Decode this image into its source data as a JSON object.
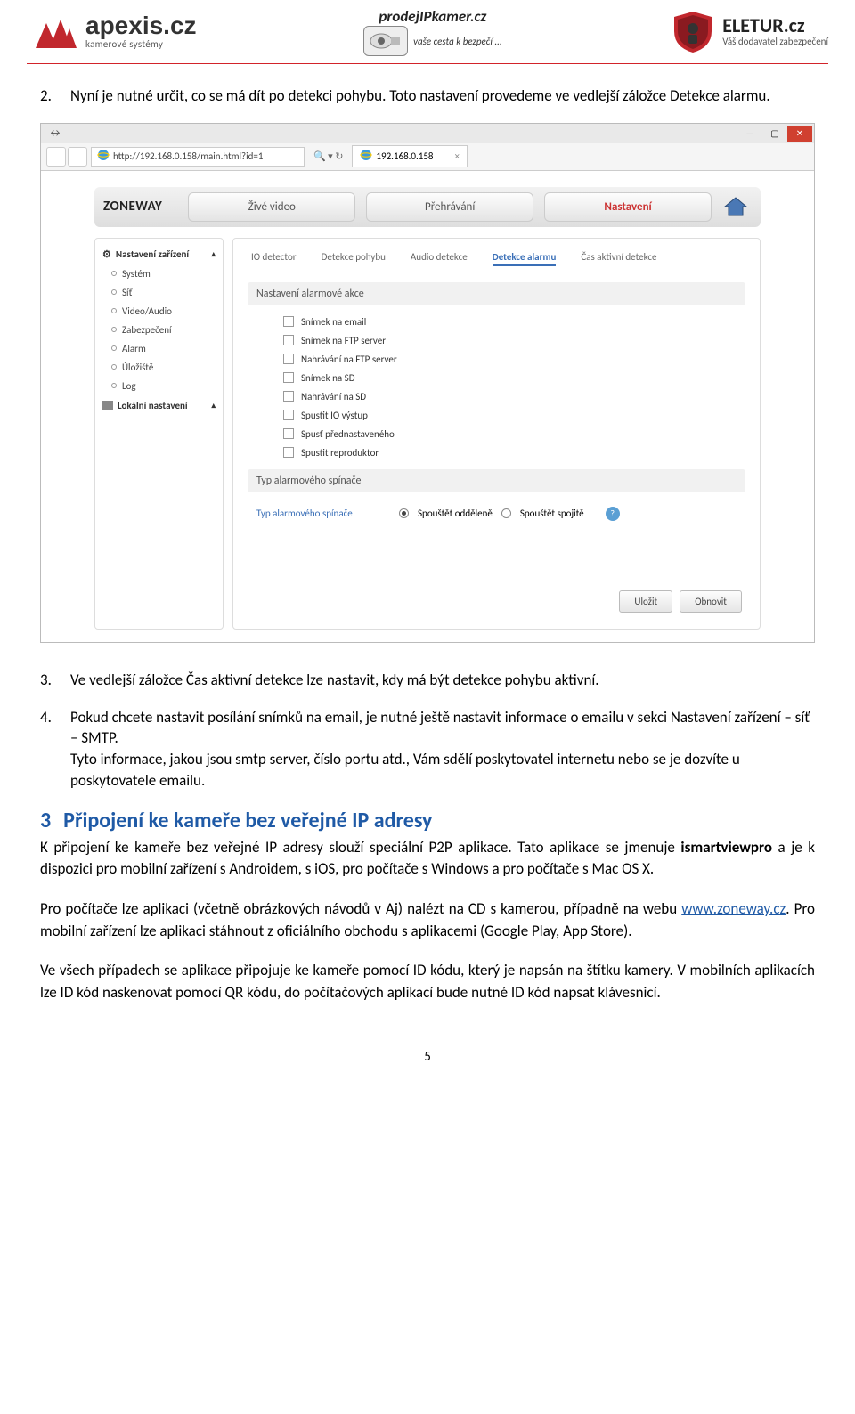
{
  "logos": {
    "apexis_main": "apexis.cz",
    "apexis_sub": "kamerové systémy",
    "prodej_top": "prodejIPkamer.cz",
    "prodej_slogan": "vaše cesta k bezpečí ...",
    "eletur_main": "ELETUR.cz",
    "eletur_sub": "Váš dodavatel zabezpečení"
  },
  "doc": {
    "item2_num": "2.",
    "item2": "Nyní je nutné určit, co se má dít po detekci pohybu. Toto nastavení provedeme ve vedlejší záložce Detekce alarmu.",
    "item3_num": "3.",
    "item3": "Ve vedlejší záložce Čas aktivní detekce lze nastavit, kdy má být detekce pohybu aktivní.",
    "item4_num": "4.",
    "item4": "Pokud chcete nastavit posílání snímků na email, je nutné ještě nastavit informace o emailu v sekci Nastavení zařízení – síť – SMTP.\nTyto informace, jakou jsou smtp server, číslo portu atd., Vám sdělí poskytovatel internetu nebo se je dozvíte u poskytovatele emailu.",
    "h2_num": "3",
    "h2": "Připojení ke kameře bez veřejné IP adresy",
    "p1a": "K připojení ke kameře bez veřejné IP adresy slouží speciální P2P aplikace. Tato aplikace se jmenuje ",
    "p1b": "ismartviewpro",
    "p1c": " a je k dispozici pro mobilní zařízení s Androidem, s iOS, pro počítače s Windows a pro počítače s Mac OS X.",
    "p2a": "Pro počítače lze aplikaci (včetně obrázkových návodů v Aj) nalézt na CD s kamerou, případně na webu ",
    "p2_link": "www.zoneway.cz",
    "p2b": ". Pro mobilní zařízení lze aplikaci stáhnout z oficiálního obchodu s aplikacemi (Google Play, App Store).",
    "p3": "Ve všech případech se aplikace připojuje ke kameře pomocí ID kódu, který je napsán na štítku kamery. V mobilních aplikacích lze ID kód naskenovat pomocí QR kódu, do počítačových aplikací bude nutné ID kód napsat klávesnicí.",
    "pagenum": "5"
  },
  "browser": {
    "url": "http://192.168.0.158/main.html?id=1",
    "tab": "192.168.0.158",
    "app_logo": "ZONEWAY",
    "tabs": {
      "live": "Živé video",
      "playback": "Přehrávání",
      "settings": "Nastavení"
    },
    "sidebar": {
      "head1": "Nastavení zařízení",
      "items": [
        "Systém",
        "Síť",
        "Video/Audio",
        "Zabezpečení",
        "Alarm",
        "Úložiště",
        "Log"
      ],
      "head2": "Lokální nastavení"
    },
    "subtabs": [
      "IO detector",
      "Detekce pohybu",
      "Audio detekce",
      "Detekce alarmu",
      "Čas aktivní detekce"
    ],
    "section1": "Nastavení alarmové akce",
    "checks": [
      "Snímek na email",
      "Snímek na FTP server",
      "Nahrávání na FTP server",
      "Snímek na SD",
      "Nahrávání na SD",
      "Spustit IO výstup",
      "Spusť přednastaveného",
      "Spustit reproduktor"
    ],
    "section2": "Typ alarmového spínače",
    "radio_label": "Typ alarmového spínače",
    "radio1": "Spouštět odděleně",
    "radio2": "Spouštět spojitě",
    "btn_save": "Uložit",
    "btn_refresh": "Obnovit"
  }
}
